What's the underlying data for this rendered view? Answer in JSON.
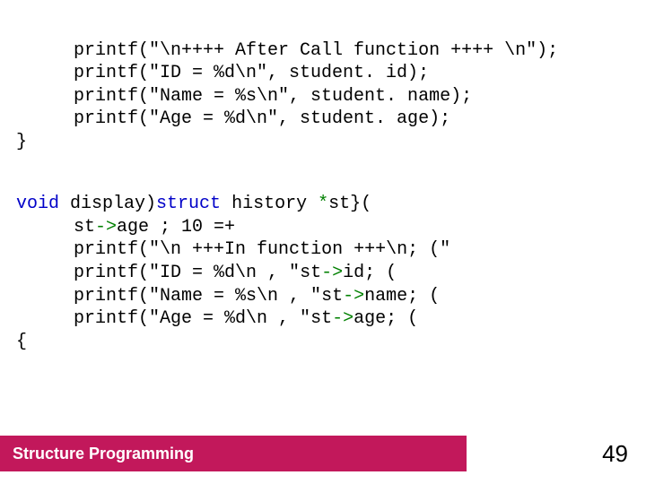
{
  "code": {
    "l1": "printf(\"\\n++++ After Call function ++++ \\n\");",
    "l2": "printf(\"ID = %d\\n\", student. id);",
    "l3": "printf(\"Name = %s\\n\", student. name);",
    "l4": "printf(\"Age = %d\\n\", student. age);",
    "l5": "}",
    "l6a": "void",
    "l6b": " display",
    "l6c": ")",
    "l6d": "struct",
    "l6e": " history ",
    "l6f": "*",
    "l6g": "st",
    "l6h": "}(",
    "l7a": "st",
    "l7b": "->",
    "l7c": "age ",
    "l7d": "; 10 =+",
    "l8a": "printf(\"\\n",
    "l8b": " +++",
    "l8c": "In function ",
    "l8d": "+++",
    "l8e": "\\n",
    "l8f": "; (\"",
    "l9a": "printf(\"ID = %d\\n",
    "l9b": " , \"",
    "l9c": "st",
    "l9d": "->",
    "l9e": "id",
    "l9f": "; (",
    "l10a": "printf(\"Name = %s\\n",
    "l10b": " , \"",
    "l10c": "st",
    "l10d": "->",
    "l10e": "name",
    "l10f": "; (",
    "l11a": "printf(\"Age = %d\\n",
    "l11b": " , \"",
    "l11c": "st",
    "l11d": "->",
    "l11e": "age",
    "l11f": "; (",
    "l12": "{"
  },
  "footer": {
    "label": "Structure Programming"
  },
  "page": {
    "num": "49"
  }
}
